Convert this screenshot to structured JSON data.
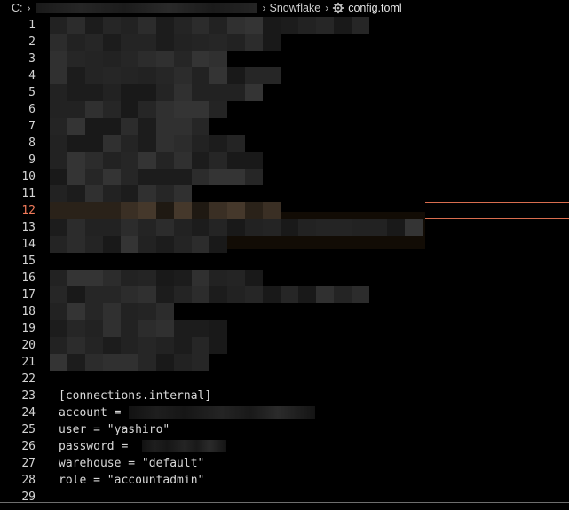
{
  "breadcrumb": {
    "drive": "C:",
    "folder": "Snowflake",
    "file": "config.toml"
  },
  "editor": {
    "active_line": 12,
    "line_numbers": [
      "1",
      "2",
      "3",
      "4",
      "5",
      "6",
      "7",
      "8",
      "9",
      "10",
      "11",
      "12",
      "13",
      "14",
      "15",
      "16",
      "17",
      "18",
      "19",
      "20",
      "21",
      "22",
      "23",
      "24",
      "25",
      "26",
      "27",
      "28",
      "29"
    ],
    "code": {
      "l23": "[connections.internal]",
      "l24": "account = ",
      "l25": "user = \"yashiro\"",
      "l26": "password = ",
      "l27": "warehouse = \"default\"",
      "l28": "role = \"accountadmin\""
    }
  },
  "colors": {
    "background": "#000000",
    "line_number": "#d4d4d4",
    "active_line_number": "#f07a5a",
    "highlight_marker": "#d96d4e"
  },
  "icons": {
    "chevron": "chevron-right-icon",
    "settings": "gear-icon"
  }
}
